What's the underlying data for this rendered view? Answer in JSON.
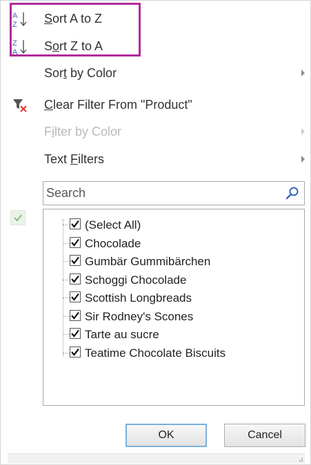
{
  "menu": {
    "sort_az": {
      "pre": "",
      "ul": "S",
      "post": "ort A to Z",
      "icon_top": "A",
      "icon_bottom": "Z"
    },
    "sort_za": {
      "pre": "S",
      "ul": "o",
      "post": "rt Z to A",
      "icon_top": "Z",
      "icon_bottom": "A"
    },
    "sort_color": {
      "pre": "Sor",
      "ul": "t",
      "post": " by Color"
    },
    "clear_filter": {
      "pre": "",
      "ul": "C",
      "post": "lear Filter From \"Product\""
    },
    "filter_color": {
      "pre": "F",
      "ul": "i",
      "post": "lter by Color"
    },
    "text_filters": {
      "pre": "Text ",
      "ul": "F",
      "post": "ilters"
    }
  },
  "search": {
    "placeholder": "Search",
    "value": ""
  },
  "list": {
    "items": [
      {
        "label": "(Select All)",
        "checked": true
      },
      {
        "label": "Chocolade",
        "checked": true
      },
      {
        "label": "Gumbär Gummibärchen",
        "checked": true
      },
      {
        "label": "Schoggi Chocolade",
        "checked": true
      },
      {
        "label": "Scottish Longbreads",
        "checked": true
      },
      {
        "label": "Sir Rodney's Scones",
        "checked": true
      },
      {
        "label": "Tarte au sucre",
        "checked": true
      },
      {
        "label": "Teatime Chocolate Biscuits",
        "checked": true
      }
    ]
  },
  "buttons": {
    "ok": "OK",
    "cancel": "Cancel"
  },
  "colors": {
    "highlight": "#b02a9a",
    "clear_filter_x": "#e8342a",
    "check_green": "#7cb36a"
  },
  "icons": {
    "sort_az": "sort-ascending-icon",
    "sort_za": "sort-descending-icon",
    "clear_filter": "clear-filter-icon",
    "search": "magnifier-icon",
    "select_all": "checkmark-icon",
    "submenu": "chevron-right-icon"
  }
}
